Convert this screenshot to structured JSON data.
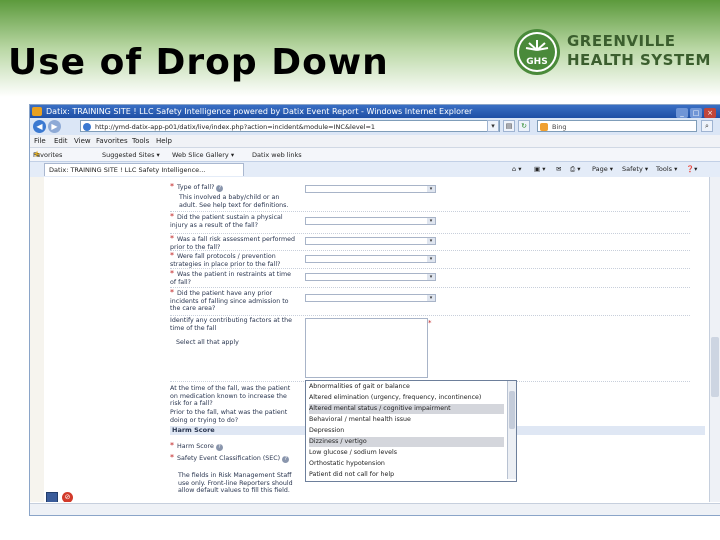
{
  "slide": {
    "title": "Use of Drop Down",
    "logo": {
      "line1": "GREENVILLE",
      "line2": "HEALTH SYSTEM",
      "mark_text": "GHS"
    }
  },
  "browser": {
    "window_title": "Datix: TRAINING SITE ! LLC Safety Intelligence powered by Datix Event Report - Windows Internet Explorer",
    "address": "http://ymd-datix-app-p01/datix/live/index.php?action=incident&module=INC&level=1",
    "search_placeholder": "Bing",
    "menu": [
      "File",
      "Edit",
      "View",
      "Favorites",
      "Tools",
      "Help"
    ],
    "favorites": {
      "label": "Favorites",
      "items": [
        "Suggested Sites ▾",
        "Web Slice Gallery ▾",
        "Datix web links"
      ]
    },
    "tab_label": "Datix: TRAINING SITE ! LLC Safety Intelligence...",
    "commands": [
      "Page ▾",
      "Safety ▾",
      "Tools ▾"
    ]
  },
  "form": {
    "questions": [
      {
        "label": "Type of fall?",
        "required": true,
        "help": true
      },
      {
        "label": "This involved a baby/child or an adult. See help text for definitions.",
        "required": false
      },
      {
        "label": "Did the patient sustain a physical injury as a result of the fall?",
        "required": true
      },
      {
        "label": "Was a fall risk assessment performed prior to the fall?",
        "required": true
      },
      {
        "label": "Were fall protocols / prevention strategies in place prior to the fall?",
        "required": true
      },
      {
        "label": "Was the patient in restraints at time of fall?",
        "required": true
      },
      {
        "label": "Did the patient have any prior incidents of falling since admission to the care area?",
        "required": true
      },
      {
        "label": "Identify any contributing factors at the time of the fall",
        "required": false
      },
      {
        "label": "Select all that apply",
        "required": false
      },
      {
        "label": "At the time of the fall, was the patient on medication known to increase the risk for a fall?",
        "required": false
      },
      {
        "label": "Prior to the fall, what was the patient doing or trying to do?",
        "required": false
      },
      {
        "label": "Harm Score",
        "required": true,
        "help": true
      },
      {
        "label": "Safety Event Classification (SEC)",
        "required": true,
        "help": true
      },
      {
        "label": "The fields in Risk Management Staff use only. Front-line Reporters should allow default values to fill this field.",
        "required": false
      }
    ],
    "section_header": "Harm Score",
    "dropdown_options": [
      {
        "label": "Abnormalities of gait or balance",
        "highlighted": false
      },
      {
        "label": "Altered elimination (urgency, frequency, incontinence)",
        "highlighted": false
      },
      {
        "label": "Altered mental status / cognitive impairment",
        "highlighted": true
      },
      {
        "label": "Behavioral / mental health issue",
        "highlighted": false
      },
      {
        "label": "Depression",
        "highlighted": false
      },
      {
        "label": "Dizziness / vertigo",
        "highlighted": true
      },
      {
        "label": "Low glucose / sodium levels",
        "highlighted": false
      },
      {
        "label": "Orthostatic hypotension",
        "highlighted": false
      },
      {
        "label": "Patient did not call for help",
        "highlighted": false
      }
    ]
  },
  "colors": {
    "brand_green": "#3b5e2e",
    "accent_blue": "#1e4fa5",
    "required": "#c02020"
  }
}
